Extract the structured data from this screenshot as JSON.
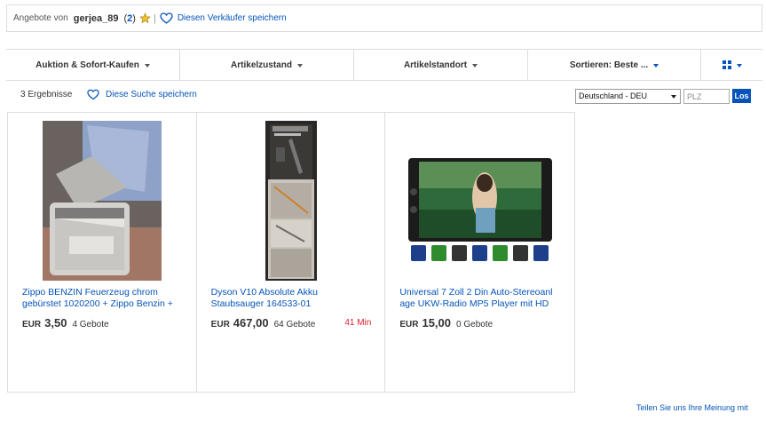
{
  "seller_bar": {
    "prefix": "Angebote von",
    "name": "gerjea_89",
    "score_open": "(",
    "score": "2",
    "score_close": ")",
    "separator": "|",
    "save_label": "Diesen Verkäufer speichern"
  },
  "filters": [
    {
      "label": "Auktion & Sofort-Kaufen"
    },
    {
      "label": "Artikelzustand"
    },
    {
      "label": "Artikelstandort"
    },
    {
      "label": "Sortieren: Beste ..."
    }
  ],
  "view_icon": "grid-view-icon",
  "results": {
    "count": "3 Ergebnisse",
    "save_search": "Diese Suche speichern"
  },
  "location": {
    "country": "Deutschland - DEU",
    "plz_placeholder": "PLZ",
    "button": "Los"
  },
  "items": [
    {
      "title_line1": "Zippo BENZIN Feuerzeug chrom",
      "title_line2": "gebürstet 1020200 + Zippo Benzin +",
      "currency": "EUR",
      "price": "3,50",
      "bids": "4 Gebote",
      "time_left": ""
    },
    {
      "title_line1": "Dyson V10 Absolute Akku",
      "title_line2": "Staubsauger 164533-01",
      "currency": "EUR",
      "price": "467,00",
      "bids": "64 Gebote",
      "time_left": "41 Min"
    },
    {
      "title_line1": "Universal 7 Zoll 2 Din Auto-Stereoanl",
      "title_line2": "age UKW-Radio MP5 Player mit HD",
      "currency": "EUR",
      "price": "15,00",
      "bids": "0 Gebote",
      "time_left": ""
    }
  ],
  "feedback": "Teilen Sie uns Ihre Meinung mit",
  "colors": {
    "link": "#0654ba",
    "time_left": "#dd1e31",
    "border": "#dddddd"
  }
}
